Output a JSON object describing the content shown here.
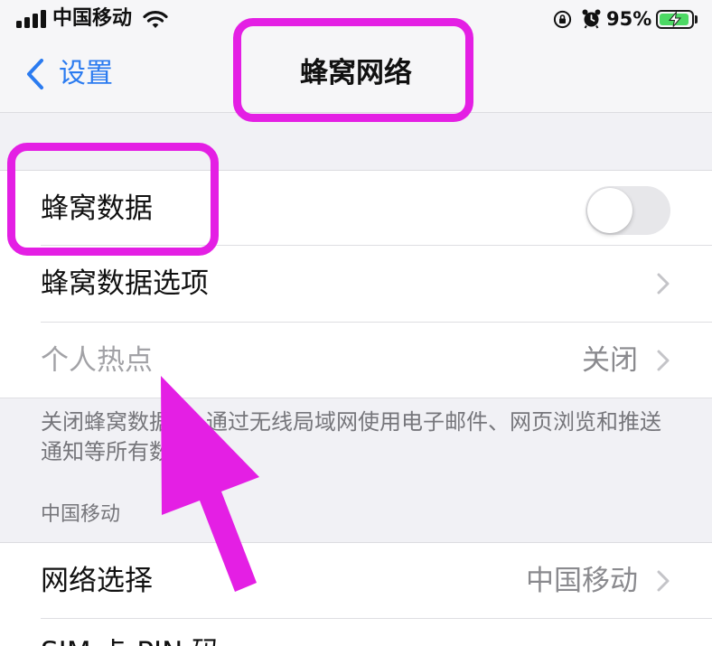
{
  "status_bar": {
    "carrier": "中国移动",
    "battery_percent": "95%",
    "battery_level": 0.95,
    "battery_charging": true
  },
  "nav": {
    "back_label": "设置",
    "title": "蜂窝网络"
  },
  "cellular_group": {
    "rows": [
      {
        "label": "蜂窝数据",
        "toggle_on": false
      },
      {
        "label": "蜂窝数据选项",
        "accessory_icon": "chevron-right-icon"
      },
      {
        "label": "个人热点",
        "value": "关闭",
        "disabled": true,
        "accessory_icon": "chevron-right-icon"
      }
    ],
    "footer": {
      "line1_start": "关闭蜂窝数据",
      "line1_end": "通过无线局域网使用电子邮件、网页浏览和推送",
      "line2": "通知等所有数"
    }
  },
  "carrier_group": {
    "header": "中国移动",
    "rows": [
      {
        "label": "网络选择",
        "value": "中国移动",
        "accessory_icon": "chevron-right-icon"
      },
      {
        "label": "SIM 卡 PIN 码"
      }
    ]
  },
  "icons": {
    "signal": "cellular-signal-icon",
    "wifi": "wifi-icon",
    "rotation_lock": "rotation-lock-icon",
    "alarm": "alarm-icon",
    "battery": "battery-charging-icon",
    "back": "chevron-left-icon",
    "disclosure": "chevron-right-icon",
    "annotation_arrow": "arrow-icon"
  },
  "colors": {
    "accent": "#2b7bf0",
    "annotation": "#e41fe4",
    "secondary_text": "#8a8a8e",
    "disabled_text": "#a2a2a6",
    "toggle_off_track": "#e7e7ea",
    "battery_fill": "#4cd964"
  }
}
